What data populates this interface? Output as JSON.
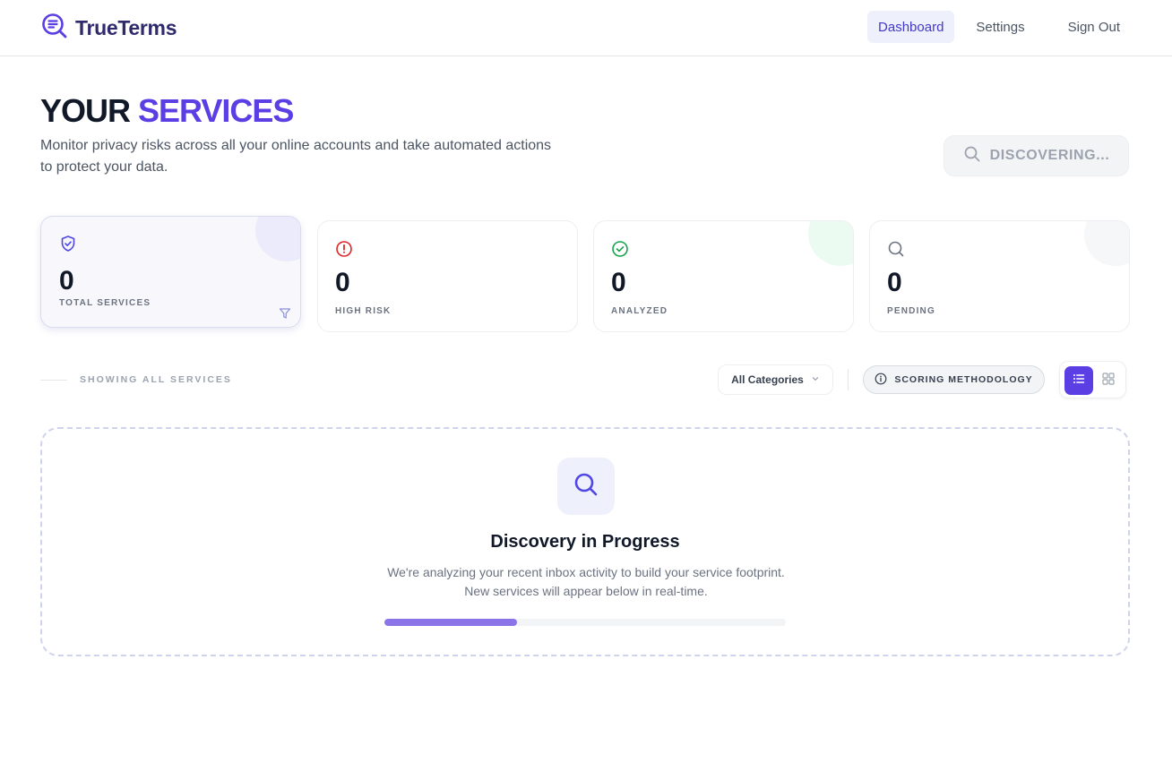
{
  "header": {
    "brand": "TrueTerms",
    "nav": [
      {
        "label": "Dashboard",
        "active": true
      },
      {
        "label": "Settings",
        "active": false
      },
      {
        "label": "Sign Out",
        "active": false
      }
    ]
  },
  "hero": {
    "title_dark": "YOUR",
    "title_accent": "SERVICES",
    "subtitle": "Monitor privacy risks across all your online accounts and take automated actions to protect your data.",
    "discover_button": "DISCOVERING..."
  },
  "stats": [
    {
      "value": "0",
      "label": "TOTAL SERVICES",
      "icon": "shield-check-icon",
      "color": "#4f46e5"
    },
    {
      "value": "0",
      "label": "HIGH RISK",
      "icon": "alert-circle-icon",
      "color": "#dc2626"
    },
    {
      "value": "0",
      "label": "ANALYZED",
      "icon": "check-circle-icon",
      "color": "#16a34a"
    },
    {
      "value": "0",
      "label": "PENDING",
      "icon": "search-icon",
      "color": "#6b7280"
    }
  ],
  "filters": {
    "showing": "SHOWING ALL SERVICES",
    "category": "All Categories",
    "methodology": "SCORING METHODOLOGY",
    "view_mode": "list"
  },
  "discovery": {
    "title": "Discovery in Progress",
    "text": "We're analyzing your recent inbox activity to build your service footprint. New services will appear below in real-time.",
    "progress": 0.33
  },
  "colors": {
    "accent": "#5b3fe4",
    "brand_dark": "#2e2a6b",
    "progress": "#8b73e8"
  }
}
